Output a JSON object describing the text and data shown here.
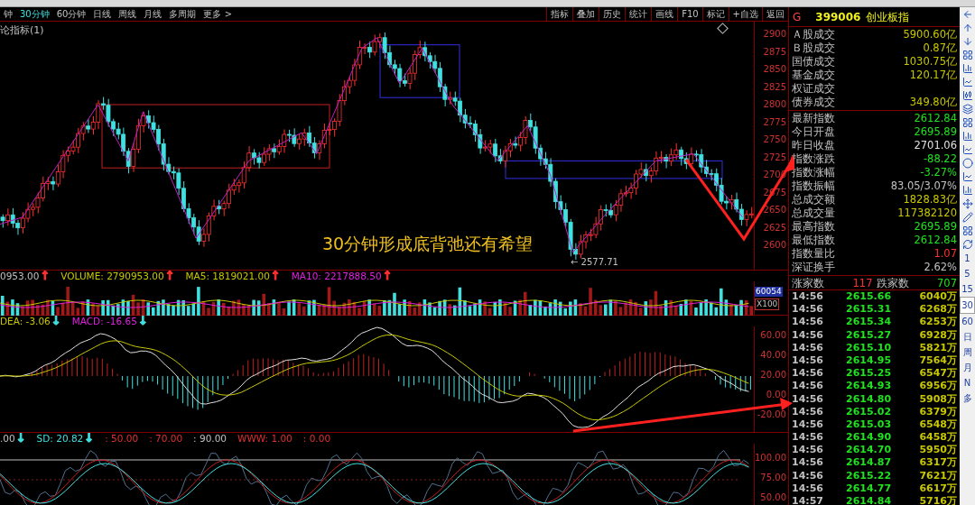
{
  "period_tabs": [
    {
      "label": "钟",
      "selected": false
    },
    {
      "label": "30分钟",
      "selected": true
    },
    {
      "label": "60分钟",
      "selected": false
    },
    {
      "label": "日线",
      "selected": false
    },
    {
      "label": "周线",
      "selected": false
    },
    {
      "label": "月线",
      "selected": false
    },
    {
      "label": "多周期",
      "selected": false
    },
    {
      "label": "更多 >",
      "selected": false
    }
  ],
  "chart_buttons": [
    "指标",
    "叠加",
    "历史",
    "统计",
    "画线",
    "F10",
    "标记",
    "+自选",
    "返回"
  ],
  "quote_header": {
    "market": "G",
    "code": "399006",
    "name": "创业板指"
  },
  "main_chart": {
    "title": "论指标(1)",
    "price_axis": [
      "2900",
      "2875",
      "2850",
      "2825",
      "2800",
      "2775",
      "2750",
      "2725",
      "2700",
      "2675",
      "2650",
      "2625",
      "2600"
    ],
    "annotation": "30分钟形成底背弛还有希望",
    "low_label": "← 2577.71"
  },
  "volume_panel": {
    "legend": [
      {
        "text": "0953.00",
        "color": "#c0c0c0",
        "arrow": {
          "text": "↑",
          "color": "#ff3030"
        }
      },
      {
        "text": "VOLUME: 2790953.00",
        "color": "#c8c800",
        "arrow": {
          "text": "↑",
          "color": "#ff3030"
        }
      },
      {
        "text": "MA5: 1819021.00",
        "color": "#c8c800",
        "arrow": {
          "text": "↑",
          "color": "#ff3030"
        }
      },
      {
        "text": "MA10: 2217888.50",
        "color": "#e020e0",
        "arrow": {
          "text": "↑",
          "color": "#ff3030"
        }
      }
    ],
    "axis": [
      "60054",
      "X100"
    ]
  },
  "macd_panel": {
    "legend": [
      {
        "text": "DEA: -3.06",
        "color": "#c8c800",
        "arrow": {
          "text": "↓",
          "color": "#40e0e0"
        }
      },
      {
        "text": "MACD: -16.65",
        "color": "#e020e0",
        "arrow": {
          "text": "↓",
          "color": "#40e0e0"
        }
      }
    ],
    "axis": [
      "60.00",
      "40.00",
      "20.00",
      "0.00",
      "-20.00"
    ]
  },
  "kdj_panel": {
    "legend": [
      {
        "text": ".00",
        "color": "#c0c0c0",
        "arrow": {
          "text": "↓",
          "color": "#40e0e0"
        }
      },
      {
        "text": "SD: 20.82",
        "color": "#40e0e0",
        "arrow": {
          "text": "↓",
          "color": "#40e0e0"
        }
      },
      {
        "text": ": 50.00",
        "color": "#e03030"
      },
      {
        "text": ": 70.00",
        "color": "#e03030"
      },
      {
        "text": ": 90.00",
        "color": "#c0c0c0"
      },
      {
        "text": "WWW: 1.00",
        "color": "#e03030"
      },
      {
        "text": ": 0.00",
        "color": "#e03030"
      }
    ],
    "axis": [
      "100.00",
      "75.00",
      "50.00"
    ]
  },
  "market_stats": [
    {
      "label": "Ａ股成交",
      "value": "5900.60亿"
    },
    {
      "label": "Ｂ股成交",
      "value": "0.87亿"
    },
    {
      "label": "国债成交",
      "value": "1030.75亿"
    },
    {
      "label": "基金成交",
      "value": "120.17亿"
    },
    {
      "label": "权证成交"
    },
    {
      "label": "债券成交",
      "value": "349.80亿"
    }
  ],
  "index_stats": [
    {
      "label": "最新指数",
      "value": "2612.84",
      "color": "#20e020"
    },
    {
      "label": "今日开盘",
      "value": "2695.89",
      "color": "#20e020"
    },
    {
      "label": "昨日收盘",
      "value": "2701.06",
      "color": "#e0e0e0"
    },
    {
      "label": "指数涨跌",
      "value": "-88.22",
      "color": "#20e020"
    },
    {
      "label": "指数涨幅",
      "value": "-3.27%",
      "color": "#20e020"
    },
    {
      "label": "指数振幅",
      "value": "83.05/3.07%",
      "color": "#c0c0c0"
    },
    {
      "label": "总成交额",
      "value": "1828.83亿",
      "color": "#c8c800"
    },
    {
      "label": "总成交量",
      "value": "117382120",
      "color": "#c8c800"
    },
    {
      "label": "最高指数",
      "value": "2695.89",
      "color": "#20e020"
    },
    {
      "label": "最低指数",
      "value": "2612.84",
      "color": "#20e020"
    },
    {
      "label": "指数量比",
      "value": "1.07",
      "color": "#ff3030"
    },
    {
      "label": "深证换手",
      "value": "2.62%",
      "color": "#c0c0c0"
    }
  ],
  "breadth": {
    "up_label": "涨家数",
    "up_count": "117",
    "down_label": "跌家数",
    "down_count": "707"
  },
  "ticks": [
    {
      "time": "14:56",
      "price": "2615.66",
      "volume": "6040万"
    },
    {
      "time": "14:56",
      "price": "2615.31",
      "volume": "6268万"
    },
    {
      "time": "14:56",
      "price": "2615.34",
      "volume": "6253万"
    },
    {
      "time": "14:56",
      "price": "2615.27",
      "volume": "6928万"
    },
    {
      "time": "14:56",
      "price": "2615.10",
      "volume": "5821万"
    },
    {
      "time": "14:56",
      "price": "2614.95",
      "volume": "7564万"
    },
    {
      "time": "14:56",
      "price": "2615.25",
      "volume": "6547万"
    },
    {
      "time": "14:56",
      "price": "2614.93",
      "volume": "6956万"
    },
    {
      "time": "14:56",
      "price": "2614.80",
      "volume": "5908万"
    },
    {
      "time": "14:56",
      "price": "2615.02",
      "volume": "6379万"
    },
    {
      "time": "14:56",
      "price": "2615.03",
      "volume": "6548万"
    },
    {
      "time": "14:56",
      "price": "2614.90",
      "volume": "6458万"
    },
    {
      "time": "14:56",
      "price": "2614.70",
      "volume": "5950万"
    },
    {
      "time": "14:56",
      "price": "2614.87",
      "volume": "6317万"
    },
    {
      "time": "14:56",
      "price": "2615.22",
      "volume": "7621万"
    },
    {
      "time": "14:56",
      "price": "2614.77",
      "volume": "6617万"
    },
    {
      "time": "14:57",
      "price": "2614.84",
      "volume": "5716万"
    }
  ],
  "side_periods": [
    {
      "label": "1",
      "selected": false
    },
    {
      "label": "5",
      "selected": false
    },
    {
      "label": "15",
      "selected": false
    },
    {
      "label": "30",
      "selected": true
    },
    {
      "label": "60",
      "selected": false
    },
    {
      "label": "日",
      "selected": false
    },
    {
      "label": "周",
      "selected": false
    },
    {
      "label": "月",
      "selected": false
    },
    {
      "label": "N",
      "selected": false
    },
    {
      "label": "多",
      "selected": false
    }
  ]
}
